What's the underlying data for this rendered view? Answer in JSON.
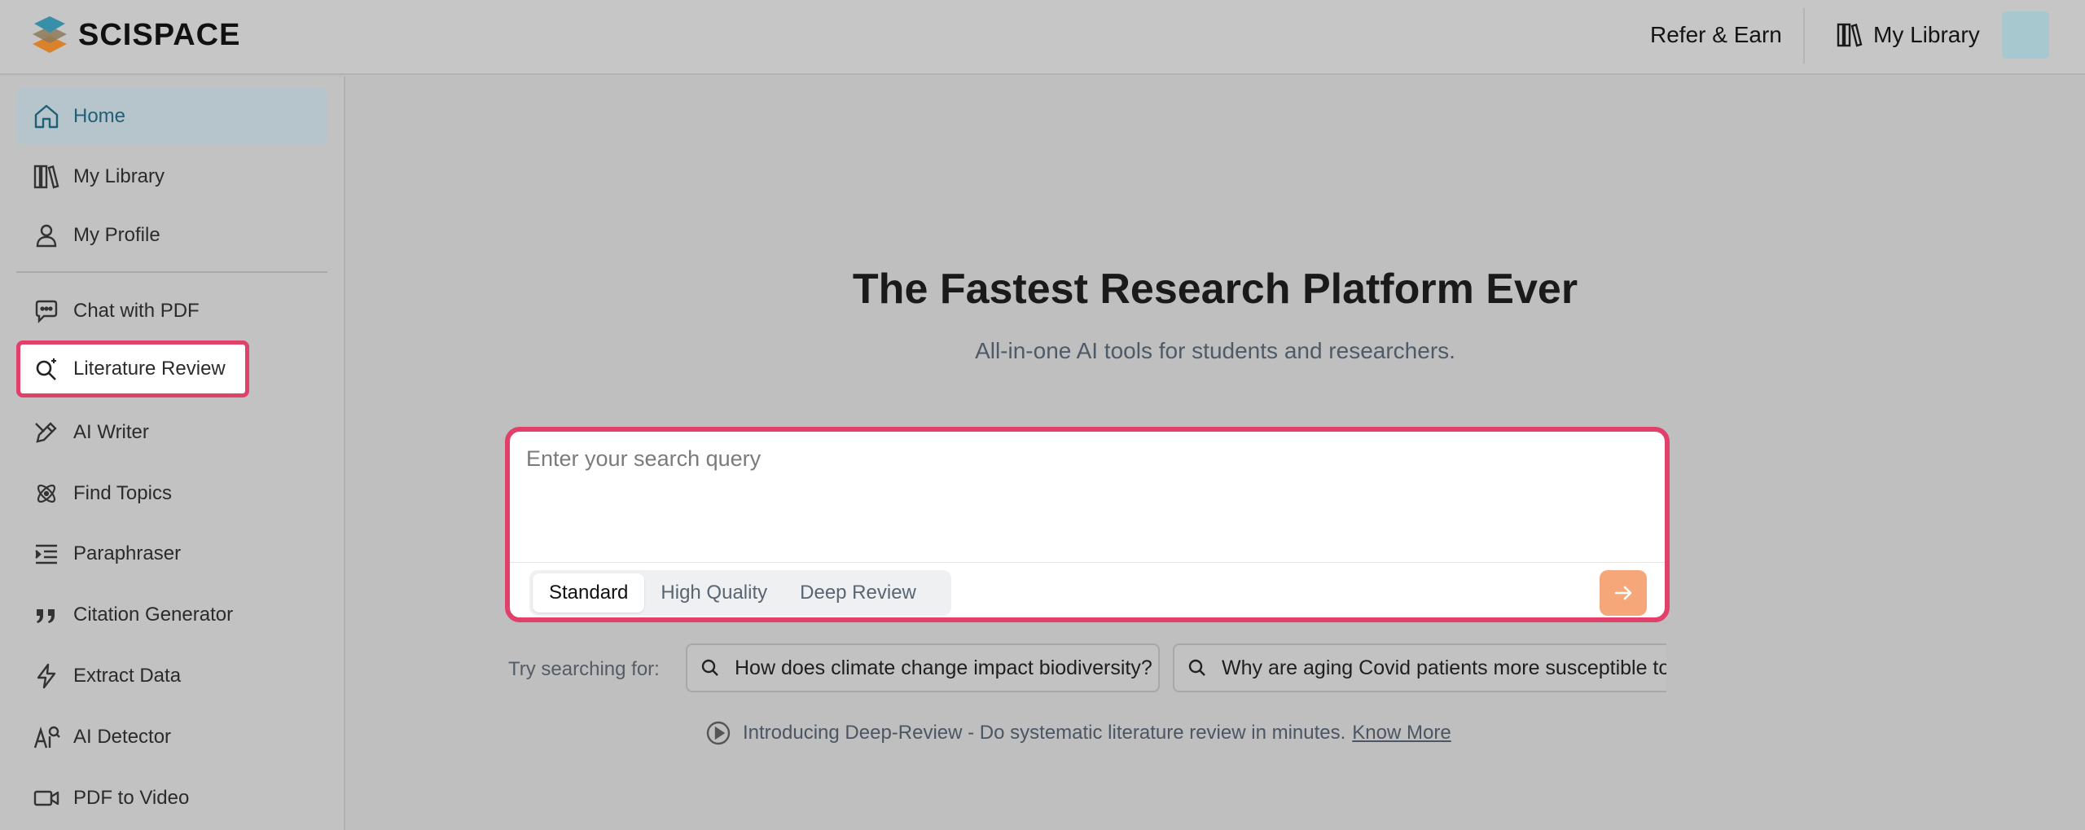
{
  "header": {
    "brand": "SCISPACE",
    "refer": "Refer & Earn",
    "my_library": "My Library"
  },
  "sidebar": {
    "items": [
      {
        "label": "Home",
        "icon": "home-icon"
      },
      {
        "label": "My Library",
        "icon": "library-icon"
      },
      {
        "label": "My Profile",
        "icon": "user-icon"
      },
      {
        "label": "Chat with PDF",
        "icon": "chat-icon"
      },
      {
        "label": "Literature Review",
        "icon": "search-sparkle-icon"
      },
      {
        "label": "AI Writer",
        "icon": "pen-icon"
      },
      {
        "label": "Find Topics",
        "icon": "atom-icon"
      },
      {
        "label": "Paraphraser",
        "icon": "indent-icon"
      },
      {
        "label": "Citation Generator",
        "icon": "quote-icon"
      },
      {
        "label": "Extract Data",
        "icon": "bolt-icon"
      },
      {
        "label": "AI Detector",
        "icon": "ai-detector-icon"
      },
      {
        "label": "PDF to Video",
        "icon": "video-icon"
      }
    ]
  },
  "main": {
    "title": "The Fastest Research Platform Ever",
    "subtitle": "All-in-one AI tools for students and researchers.",
    "search": {
      "placeholder": "Enter your search query",
      "value": "",
      "modes": [
        "Standard",
        "High Quality",
        "Deep Review"
      ],
      "selected_mode": "Standard"
    },
    "try_label": "Try searching for:",
    "suggestions": [
      "How does climate change impact biodiversity?",
      "Why are aging Covid patients more susceptible to"
    ],
    "intro_text": "Introducing Deep-Review - Do systematic literature review in minutes.",
    "intro_link": "Know More"
  },
  "colors": {
    "highlight": "#e0406a",
    "accent_send": "#f5a77a",
    "active_nav_bg": "#b6c5cb",
    "active_nav_text": "#1f5f77"
  }
}
